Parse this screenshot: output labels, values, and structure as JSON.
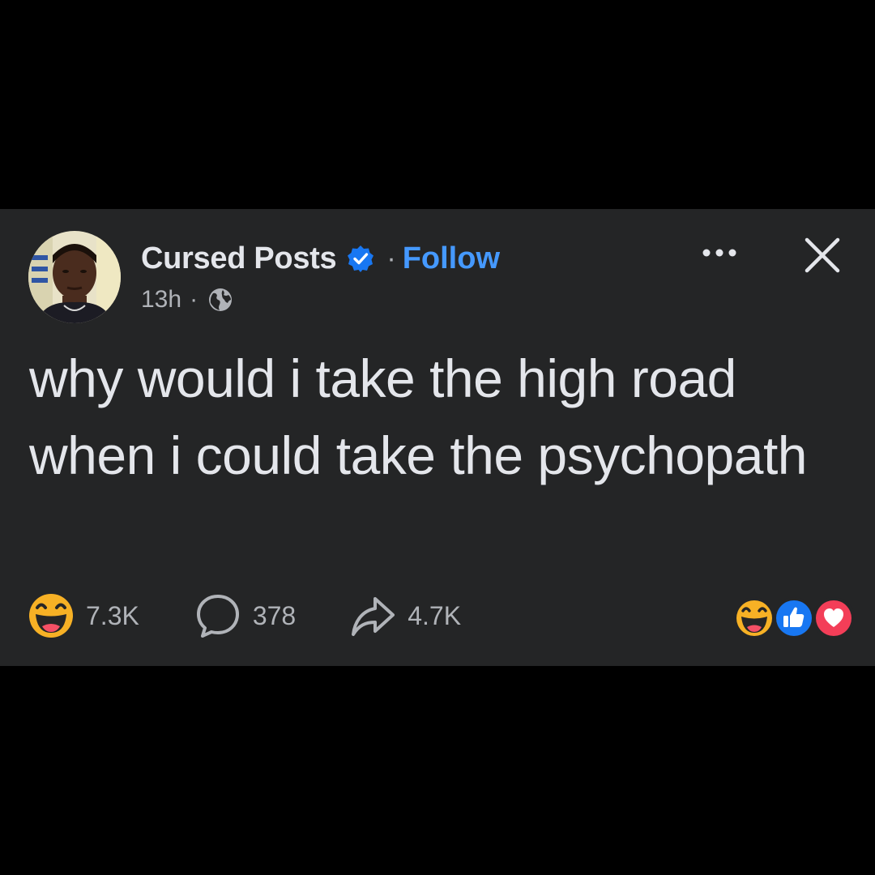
{
  "post": {
    "author": "Cursed Posts",
    "separator": "·",
    "follow_label": "Follow",
    "timestamp": "13h",
    "meta_separator": "·",
    "audience_icon": "globe-icon",
    "text": "why would i take the high road when i could take the psychopath"
  },
  "stats": {
    "reactions_count": "7.3K",
    "comments_count": "378",
    "shares_count": "4.7K"
  },
  "icons": {
    "verified": "verified-badge-icon",
    "more": "more-options-icon",
    "close": "close-icon",
    "reaction": "haha-reaction-icon",
    "comment": "comment-bubble-icon",
    "share": "share-arrow-icon",
    "stack": [
      "haha-reaction-icon",
      "like-reaction-icon",
      "love-reaction-icon"
    ]
  },
  "colors": {
    "background": "#000000",
    "card": "#242526",
    "text_primary": "#e4e6eb",
    "text_secondary": "#b0b3b8",
    "accent_blue": "#4599ff",
    "like_blue": "#1877f2",
    "love_red": "#f33e58",
    "haha_yellow": "#f7b125"
  }
}
